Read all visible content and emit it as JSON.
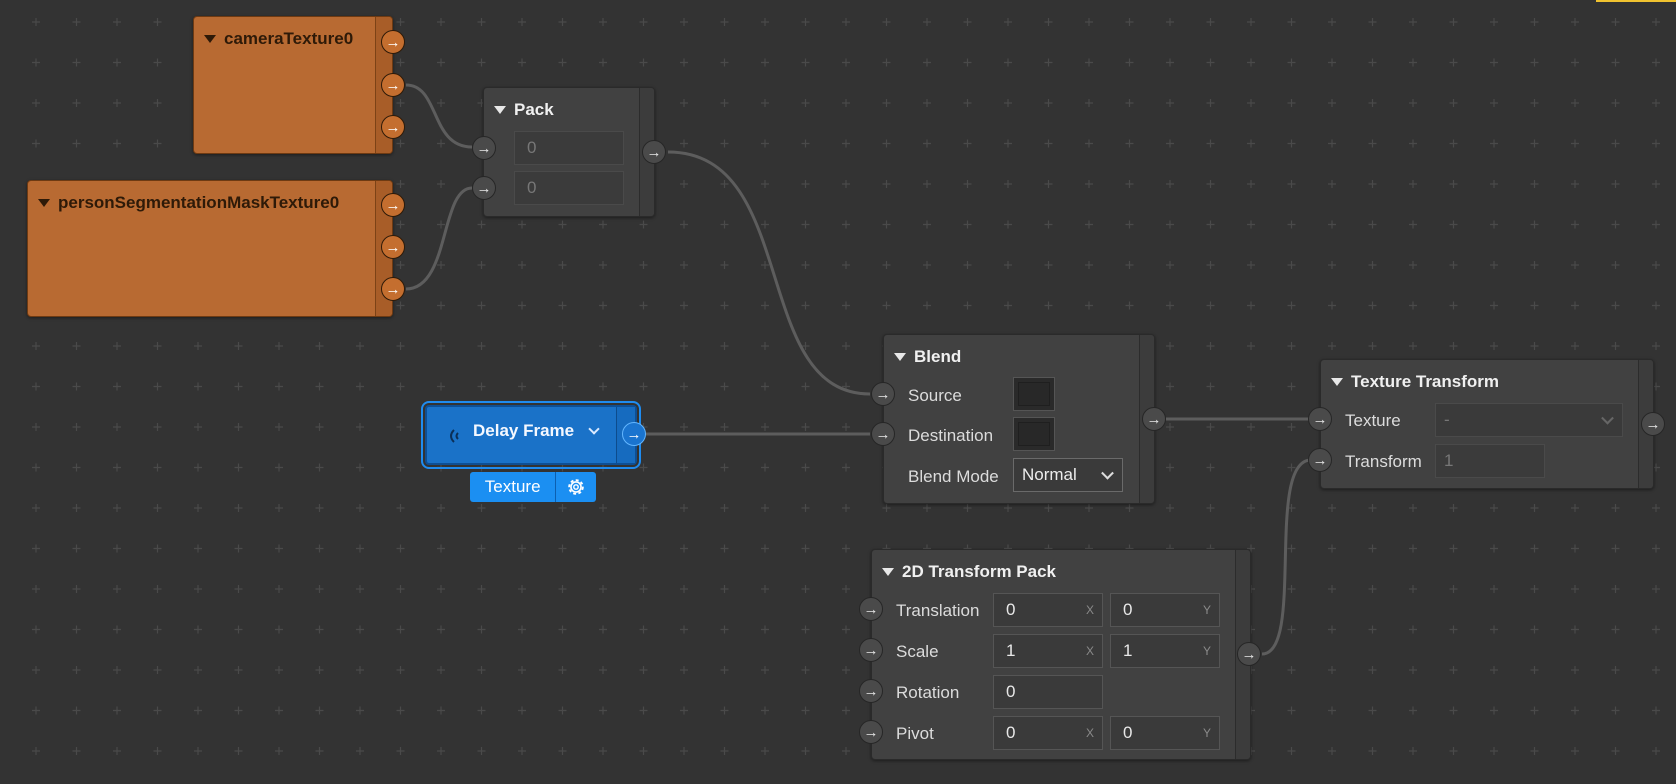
{
  "nodes": {
    "camera_texture": {
      "title": "cameraTexture0",
      "color": "#b86a32"
    },
    "person_segmentation": {
      "title": "personSegmentationMaskTexture0",
      "color": "#b86a32"
    },
    "pack": {
      "title": "Pack",
      "inputs": [
        "0",
        "0"
      ]
    },
    "blend": {
      "title": "Blend",
      "source_label": "Source",
      "destination_label": "Destination",
      "blend_mode_label": "Blend Mode",
      "blend_mode_value": "Normal"
    },
    "delay_frame": {
      "title": "Delay Frame",
      "badge_label": "Texture",
      "color": "#1a72c8"
    },
    "texture_transform": {
      "title": "Texture Transform",
      "texture_label": "Texture",
      "texture_value": "-",
      "transform_label": "Transform",
      "transform_value": "1"
    },
    "transform_pack": {
      "title": "2D Transform Pack",
      "translation_label": "Translation",
      "translation_x": "0",
      "translation_y": "0",
      "scale_label": "Scale",
      "scale_x": "1",
      "scale_y": "1",
      "rotation_label": "Rotation",
      "rotation_value": "0",
      "pivot_label": "Pivot",
      "pivot_x": "0",
      "pivot_y": "0",
      "axis_x": "X",
      "axis_y": "Y"
    }
  },
  "colors": {
    "canvas": "#333333",
    "wire": "#5d5d5d",
    "selection": "#1f8cf0",
    "accent": "#f0c330"
  },
  "icons": [
    "arrow-right-icon",
    "collapse-triangle-icon",
    "chevron-down-icon",
    "signal-icon",
    "gear-icon"
  ]
}
